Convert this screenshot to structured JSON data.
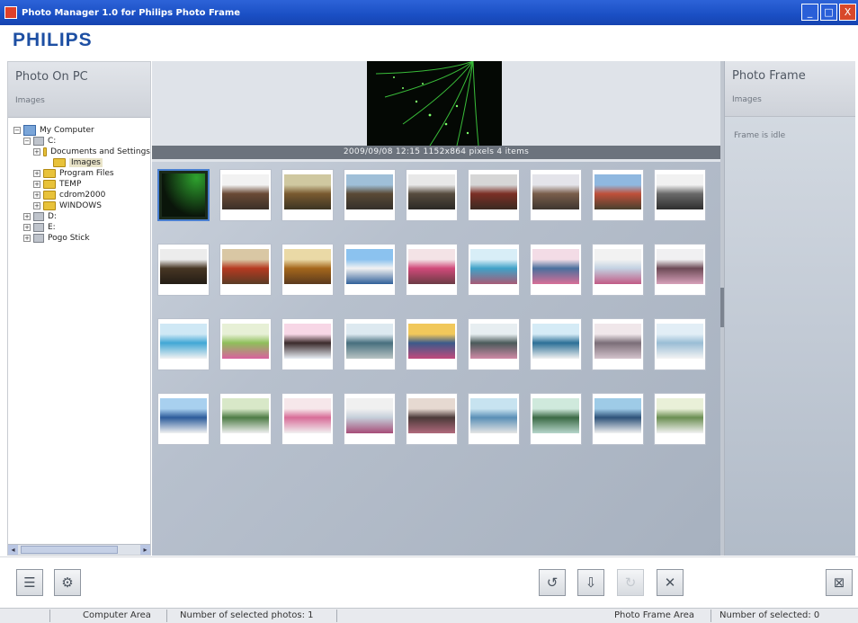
{
  "window": {
    "title": "Photo Manager 1.0 for Philips Photo Frame",
    "minimize": "_",
    "maximize": "□",
    "close": "X"
  },
  "brand": "PHILIPS",
  "left_panel": {
    "title": "Photo On PC",
    "subtitle": "Images",
    "tree": [
      {
        "label": "My Computer",
        "indent": 0,
        "icon": "computer-icon",
        "expander": "−"
      },
      {
        "label": "C:",
        "indent": 1,
        "icon": "drive-icon",
        "expander": "−"
      },
      {
        "label": "Documents and Settings",
        "indent": 2,
        "icon": "folder-icon",
        "expander": "+"
      },
      {
        "label": "Images",
        "indent": 3,
        "icon": "folder-icon",
        "expander": "",
        "selected": true
      },
      {
        "label": "Program Files",
        "indent": 2,
        "icon": "folder-icon",
        "expander": "+"
      },
      {
        "label": "TEMP",
        "indent": 2,
        "icon": "folder-icon",
        "expander": "+"
      },
      {
        "label": "cdrom2000",
        "indent": 2,
        "icon": "folder-icon",
        "expander": "+"
      },
      {
        "label": "WINDOWS",
        "indent": 2,
        "icon": "folder-icon",
        "expander": "+"
      },
      {
        "label": "D:",
        "indent": 1,
        "icon": "drive-icon",
        "expander": "+"
      },
      {
        "label": "E:",
        "indent": 1,
        "icon": "drive-icon",
        "expander": "+"
      },
      {
        "label": "Pogo Stick",
        "indent": 1,
        "icon": "drive-icon",
        "expander": "+"
      }
    ]
  },
  "preview": {
    "info": "2009/09/08 12:15  1152x864 pixels  4 items"
  },
  "thumbnails": [
    {
      "colors": [
        "#0a150a",
        "#2ea22e",
        "#0a150a"
      ],
      "selected": true
    },
    {
      "colors": [
        "#f2f2f2",
        "#6a4a35",
        "#3b3028"
      ]
    },
    {
      "colors": [
        "#cfc8a0",
        "#7a5a30",
        "#3c3523"
      ]
    },
    {
      "colors": [
        "#9fbfd8",
        "#5a4a36",
        "#34302b"
      ]
    },
    {
      "colors": [
        "#e8e8e8",
        "#574c3f",
        "#2b2925"
      ]
    },
    {
      "colors": [
        "#d6d6d6",
        "#7c2f25",
        "#3a2a22"
      ]
    },
    {
      "colors": [
        "#e4e4ea",
        "#7a5e4b",
        "#3e3630"
      ]
    },
    {
      "colors": [
        "#8fb8e0",
        "#c0503a",
        "#48402f"
      ]
    },
    {
      "colors": [
        "#f1f1f1",
        "#6a6a6a",
        "#2e2e2e"
      ]
    },
    {
      "colors": [
        "#ececec",
        "#473624",
        "#241d15"
      ]
    },
    {
      "colors": [
        "#d9c7a4",
        "#b63a21",
        "#5a3b24"
      ]
    },
    {
      "colors": [
        "#ead9a6",
        "#a5671c",
        "#5b3a1d"
      ]
    },
    {
      "colors": [
        "#8bc2ef",
        "#f2f2f2",
        "#2f5f99"
      ]
    },
    {
      "colors": [
        "#f3e3e6",
        "#d14a7a",
        "#6b3b44"
      ]
    },
    {
      "colors": [
        "#d8eef7",
        "#3fa2c8",
        "#a75b76"
      ]
    },
    {
      "colors": [
        "#f3dce6",
        "#4a6f9d",
        "#d86f97"
      ]
    },
    {
      "colors": [
        "#f2f2f2",
        "#c3d2e2",
        "#c15a85"
      ]
    },
    {
      "colors": [
        "#f0f0f2",
        "#6d4a56",
        "#d6a0b9"
      ]
    },
    {
      "colors": [
        "#cfe8f5",
        "#41a7d5",
        "#f2f2f2"
      ]
    },
    {
      "colors": [
        "#e7f0d6",
        "#8fbf5b",
        "#d9619e"
      ]
    },
    {
      "colors": [
        "#f7d7e6",
        "#3b2b2c",
        "#e8eef5"
      ]
    },
    {
      "colors": [
        "#dde9f0",
        "#476f7e",
        "#b9c4c4"
      ]
    },
    {
      "colors": [
        "#f1c85b",
        "#3b5a8a",
        "#c24a7c"
      ]
    },
    {
      "colors": [
        "#e7eef1",
        "#4a5a5a",
        "#d08aa6"
      ]
    },
    {
      "colors": [
        "#d5ebf6",
        "#2b6f96",
        "#f1f1f1"
      ]
    },
    {
      "colors": [
        "#f0e7ea",
        "#7b6e78",
        "#d4c3cc"
      ]
    },
    {
      "colors": [
        "#e2eef6",
        "#99bdd5",
        "#f4f4f4"
      ]
    },
    {
      "colors": [
        "#a8d0ef",
        "#2d5c9b",
        "#f2f2f2"
      ]
    },
    {
      "colors": [
        "#d8e8c8",
        "#4e7c46",
        "#f0f0f0"
      ]
    },
    {
      "colors": [
        "#f6e7ea",
        "#d86d98",
        "#f1f1f1"
      ]
    },
    {
      "colors": [
        "#f0f0f0",
        "#c5cfda",
        "#a64c77"
      ]
    },
    {
      "colors": [
        "#e6d9d1",
        "#4b3a39",
        "#b06a7c"
      ]
    },
    {
      "colors": [
        "#c7e3f0",
        "#5a8fb6",
        "#e5e5e5"
      ]
    },
    {
      "colors": [
        "#cfe9dc",
        "#3b6a45",
        "#b7d6cb"
      ]
    },
    {
      "colors": [
        "#9ecbe7",
        "#2e5279",
        "#f3f3f3"
      ]
    },
    {
      "colors": [
        "#e9f0d8",
        "#6b8e52",
        "#f3f3f3"
      ]
    }
  ],
  "right_panel": {
    "title": "Photo Frame",
    "subtitle": "Images",
    "empty_text": "Frame is idle"
  },
  "toolbar": {
    "left_buttons": [
      {
        "name": "properties-button",
        "glyph": "☰"
      },
      {
        "name": "settings-button",
        "glyph": "⚙"
      }
    ],
    "right_buttons": [
      {
        "name": "rotate-left-button",
        "glyph": "↺",
        "disabled": false
      },
      {
        "name": "copy-to-frame-button",
        "glyph": "⇩",
        "disabled": false
      },
      {
        "name": "rotate-right-button",
        "glyph": "↻",
        "disabled": true
      },
      {
        "name": "delete-button",
        "glyph": "✕",
        "disabled": false
      }
    ],
    "exit_button": {
      "glyph": "⊠"
    }
  },
  "status": {
    "area": "Computer Area",
    "selected": "Number of selected photos: 1",
    "frame_area": "Photo Frame Area",
    "frame_selected": "Number of selected: 0"
  },
  "colors": {
    "brand": "#1d4fa3",
    "titlebar": "#1a4fc4",
    "selection_border": "#4a7fd0"
  }
}
